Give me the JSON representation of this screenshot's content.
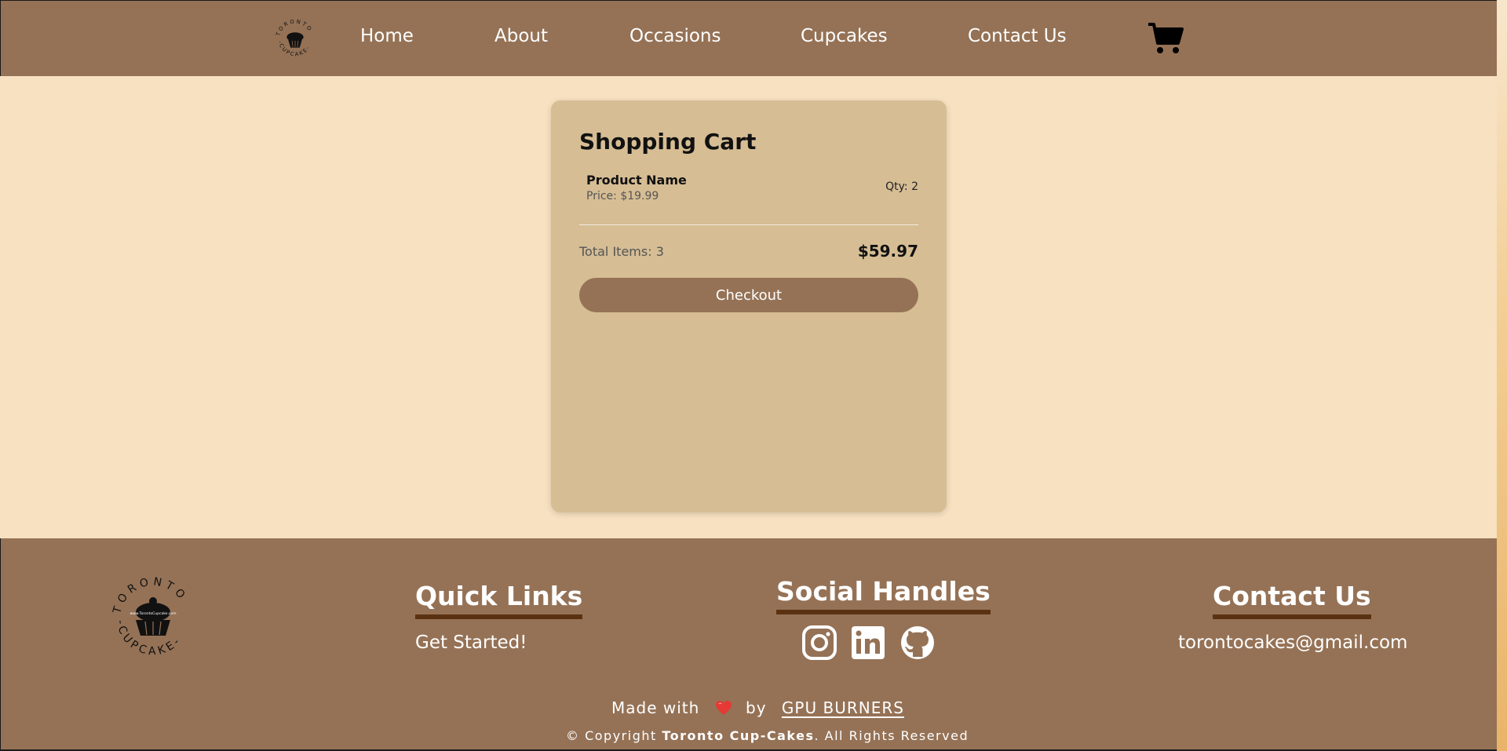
{
  "header": {
    "logo_text": "TORONTO CUPCAKE",
    "nav": [
      {
        "label": "Home"
      },
      {
        "label": "About"
      },
      {
        "label": "Occasions"
      },
      {
        "label": "Cupcakes"
      },
      {
        "label": "Contact Us"
      }
    ],
    "cart_icon": "shopping-cart-icon"
  },
  "cart": {
    "title": "Shopping Cart",
    "items": [
      {
        "name": "Product Name",
        "price": "Price: $19.99",
        "qty": "Qty: 2"
      }
    ],
    "total_items": "Total Items: 3",
    "total_price": "$59.97",
    "checkout_label": "Checkout"
  },
  "footer": {
    "logo_text": "TORONTO CUPCAKE",
    "logo_url_text": "www.TorontoCupcake.com",
    "quick_links": {
      "heading": "Quick Links",
      "items": [
        "Get Started!"
      ]
    },
    "social": {
      "heading": "Social Handles",
      "icons": [
        "instagram-icon",
        "linkedin-icon",
        "github-icon"
      ]
    },
    "contact": {
      "heading": "Contact Us",
      "email": "torontocakes@gmail.com"
    },
    "made_with_prefix": "Made with",
    "made_with_by": "by",
    "made_with_brand": "GPU BURNERS",
    "copyright_prefix": "© Copyright",
    "copyright_brand": "Toronto Cup-Cakes",
    "copyright_suffix": ". All Rights Reserved"
  },
  "colors": {
    "header_bg": "#957256",
    "page_bg": "#f7e1c1",
    "card_bg": "#d6bd94",
    "button_bg": "#957256",
    "heading_underline": "#5b3211",
    "heart": "#e53935"
  }
}
